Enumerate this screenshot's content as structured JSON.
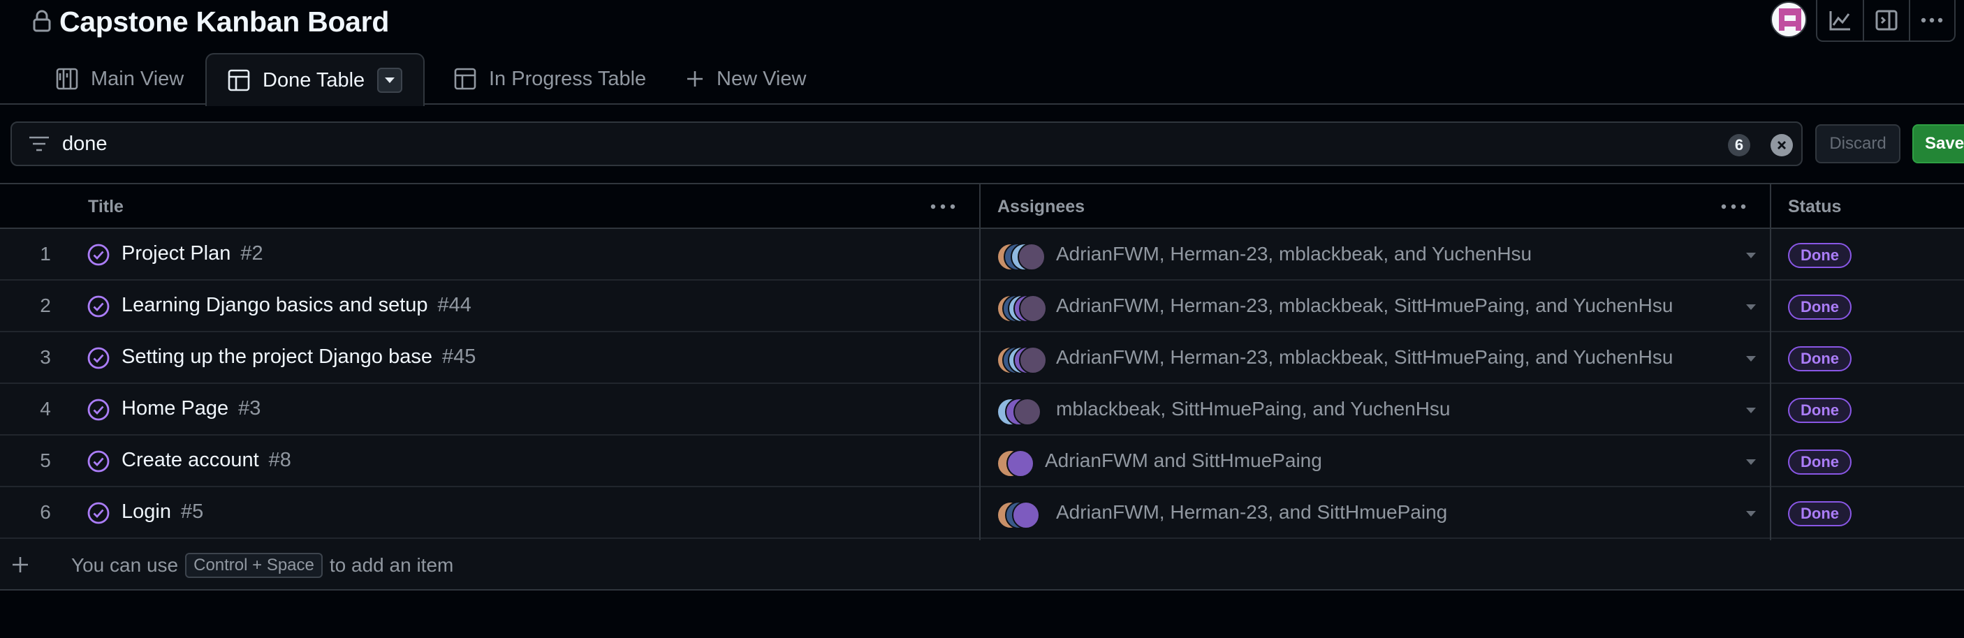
{
  "project": {
    "title": "Capstone Kanban Board"
  },
  "tabs": [
    {
      "label": "Main View",
      "icon": "board-icon"
    },
    {
      "label": "Done Table",
      "icon": "table-icon"
    },
    {
      "label": "In Progress Table",
      "icon": "table-icon"
    },
    {
      "label": "New View",
      "icon": "plus-icon"
    }
  ],
  "filter": {
    "query": "done",
    "count": "6"
  },
  "buttons": {
    "discard": "Discard",
    "save": "Save"
  },
  "table": {
    "columns": {
      "title": "Title",
      "assignees": "Assignees",
      "status": "Status"
    },
    "rows": [
      {
        "num": "1",
        "title": "Project Plan",
        "issue": "#2",
        "assignees": "AdrianFWM, Herman-23, mblackbeak, and YuchenHsu",
        "status": "Done"
      },
      {
        "num": "2",
        "title": "Learning Django basics and setup",
        "issue": "#44",
        "assignees": "AdrianFWM, Herman-23, mblackbeak, SittHmuePaing, and YuchenHsu",
        "status": "Done"
      },
      {
        "num": "3",
        "title": "Setting up the project Django base",
        "issue": "#45",
        "assignees": "AdrianFWM, Herman-23, mblackbeak, SittHmuePaing, and YuchenHsu",
        "status": "Done"
      },
      {
        "num": "4",
        "title": "Home Page",
        "issue": "#3",
        "assignees": "mblackbeak, SittHmuePaing, and YuchenHsu",
        "status": "Done"
      },
      {
        "num": "5",
        "title": "Create account",
        "issue": "#8",
        "assignees": "AdrianFWM and SittHmuePaing",
        "status": "Done"
      },
      {
        "num": "6",
        "title": "Login",
        "issue": "#5",
        "assignees": "AdrianFWM, Herman-23, and SittHmuePaing",
        "status": "Done"
      }
    ]
  },
  "add_item": {
    "prefix": "You can use",
    "shortcut": "Control + Space",
    "suffix": "to add an item"
  },
  "colors": {
    "accent_done": "#8957e5",
    "save_green": "#238636",
    "background": "#010409"
  }
}
